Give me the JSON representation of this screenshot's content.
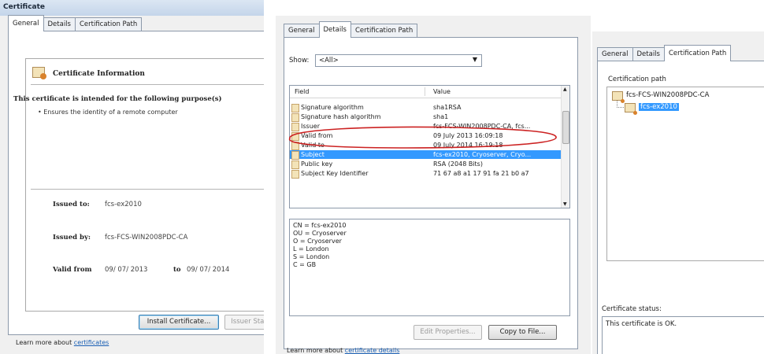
{
  "general": {
    "window_title": "Certificate",
    "tabs": [
      "General",
      "Details",
      "Certification Path"
    ],
    "info_title": "Certificate Information",
    "purpose_heading": "This certificate is intended for the following purpose(s)",
    "purpose_item": "• Ensures the identity of a remote computer",
    "issued_to_label": "Issued to:",
    "issued_to_value": "fcs-ex2010",
    "issued_by_label": "Issued by:",
    "issued_by_value": "fcs-FCS-WIN2008PDC-CA",
    "valid_from_label": "Valid from",
    "valid_from_value": "09/ 07/ 2013",
    "valid_to_label": "to",
    "valid_to_value": "09/ 07/ 2014",
    "install_button": "Install Certificate...",
    "issuer_statement_button": "Issuer Stat",
    "learn_more": "Learn more about",
    "learn_more_link": "certificates"
  },
  "details": {
    "tabs": [
      "General",
      "Details",
      "Certification Path"
    ],
    "show_label": "Show:",
    "show_value": "<All>",
    "columns": [
      "Field",
      "Value"
    ],
    "rows": [
      {
        "field": "Signature algorithm",
        "value": "sha1RSA"
      },
      {
        "field": "Signature hash algorithm",
        "value": "sha1"
      },
      {
        "field": "Issuer",
        "value": "fcs-FCS-WIN2008PDC-CA, fcs..."
      },
      {
        "field": "Valid from",
        "value": "09 July 2013 16:09:18"
      },
      {
        "field": "Valid to",
        "value": "09 July 2014 16:19:18"
      },
      {
        "field": "Subject",
        "value": "fcs-ex2010, Cryoserver, Cryo..."
      },
      {
        "field": "Public key",
        "value": "RSA (2048 Bits)"
      },
      {
        "field": "Subject Key Identifier",
        "value": "71 67 a8 a1 17 91 fa 21 b0 a7"
      }
    ],
    "selected_row": 5,
    "circled_row": 2,
    "detail_lines": [
      "CN = fcs-ex2010",
      "OU = Cryoserver",
      "O = Cryoserver",
      "L = London",
      "S = London",
      "C = GB"
    ],
    "edit_button": "Edit Properties...",
    "copy_button": "Copy to File...",
    "learn_more": "Learn more about",
    "learn_more_link": "certificate details",
    "accent_color": "#3399ff",
    "annotation_color": "#cc2222"
  },
  "path": {
    "tabs": [
      "General",
      "Details",
      "Certification Path"
    ],
    "path_label": "Certification path",
    "root_node": "fcs-FCS-WIN2008PDC-CA",
    "child_node": "fcs-ex2010",
    "status_label": "Certificate status:",
    "status_text": "This certificate is OK."
  }
}
